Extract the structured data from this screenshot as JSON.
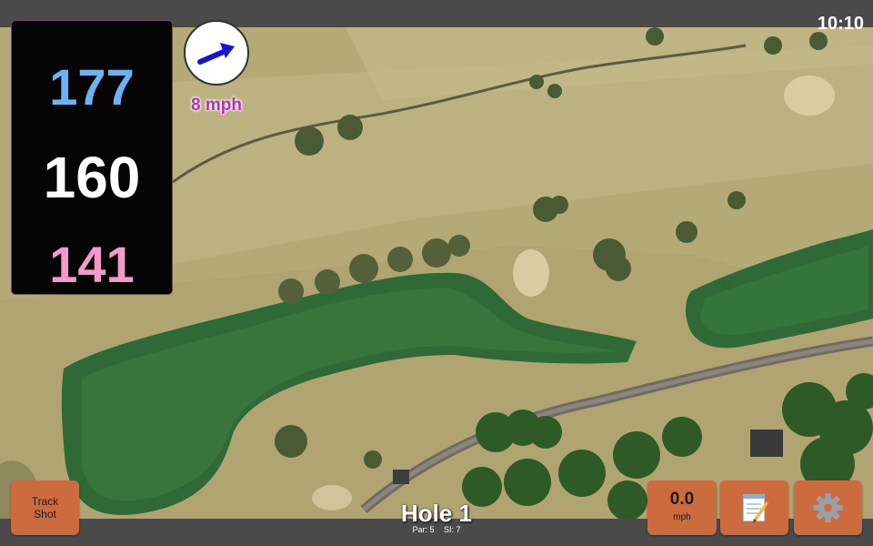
{
  "status": {
    "time": "10:10"
  },
  "distances": {
    "back": "177",
    "center": "160",
    "front": "141"
  },
  "wind": {
    "direction_icon": "arrow-right-icon",
    "speed_label": "8 mph"
  },
  "hole": {
    "title": "Hole 1",
    "par_label": "Par: 5",
    "si_label": "SI: 7"
  },
  "buttons": {
    "track_shot": [
      "Track",
      "Shot"
    ],
    "wind_value": "0.0",
    "wind_unit": "mph",
    "notes_icon": "notepad-icon",
    "settings_icon": "gear-icon"
  },
  "colors": {
    "back": "#6ab4f4",
    "center": "#ffffff",
    "front": "#f39ac8",
    "button": "#cc6c3e",
    "wind_label": "#b431b1"
  }
}
